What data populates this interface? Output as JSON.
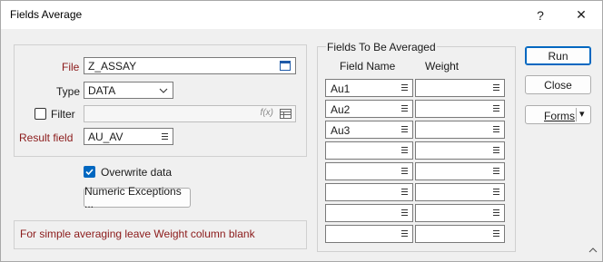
{
  "window": {
    "title": "Fields Average",
    "help_glyph": "?",
    "close_glyph": "✕"
  },
  "left": {
    "file_label": "File",
    "file_value": "Z_ASSAY",
    "type_label": "Type",
    "type_value": "DATA",
    "filter_label": "Filter",
    "filter_checked": false,
    "filter_value": "",
    "filter_fx": "f(x)",
    "result_label": "Result field",
    "result_value": "AU_AV",
    "overwrite_label": "Overwrite data",
    "overwrite_checked": true,
    "numeric_exceptions_label": "Numeric Exceptions ...",
    "note": "For simple averaging leave Weight column blank"
  },
  "grid": {
    "group_title": "Fields To Be Averaged",
    "col_field_name": "Field Name",
    "col_weight": "Weight",
    "rows": [
      {
        "field": "Au1",
        "weight": ""
      },
      {
        "field": "Au2",
        "weight": ""
      },
      {
        "field": "Au3",
        "weight": ""
      },
      {
        "field": "",
        "weight": ""
      },
      {
        "field": "",
        "weight": ""
      },
      {
        "field": "",
        "weight": ""
      },
      {
        "field": "",
        "weight": ""
      },
      {
        "field": "",
        "weight": ""
      }
    ]
  },
  "buttons": {
    "run": "Run",
    "close": "Close",
    "forms": "Forms",
    "forms_arrow": "▾"
  },
  "colors": {
    "accent": "#0067c0",
    "required_label": "#8b1a1a",
    "note_text": "#8b1a1a"
  }
}
